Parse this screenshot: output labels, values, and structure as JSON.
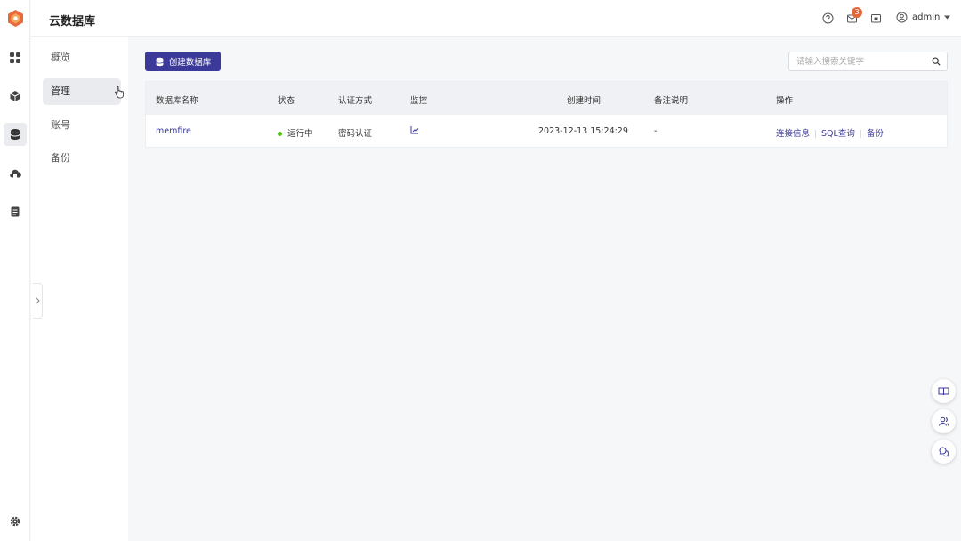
{
  "app": {
    "title": "云数据库"
  },
  "header": {
    "notification_count": "3",
    "user_name": "admin"
  },
  "rail": {
    "icons": [
      "dashboard-icon",
      "cube-icon",
      "database-icon",
      "cloud-storage-icon",
      "document-icon",
      "settings-icon"
    ],
    "active": "database-icon"
  },
  "subnav": {
    "items": [
      {
        "label": "概览"
      },
      {
        "label": "管理"
      },
      {
        "label": "账号"
      },
      {
        "label": "备份"
      }
    ],
    "active": "管理"
  },
  "toolbar": {
    "create_label": "创建数据库",
    "search_placeholder": "请输入搜索关键字"
  },
  "table": {
    "headers": [
      "数据库名称",
      "状态",
      "认证方式",
      "监控",
      "创建时间",
      "备注说明",
      "操作"
    ],
    "rows": [
      {
        "name": "memfire",
        "status": "运行中",
        "auth": "密码认证",
        "created": "2023-12-13 15:24:29",
        "remark": "-",
        "actions": [
          "连接信息",
          "SQL查询",
          "备份"
        ]
      }
    ]
  },
  "colors": {
    "primary": "#3b3a98",
    "running": "#52c41a",
    "badge": "#e2683c"
  }
}
